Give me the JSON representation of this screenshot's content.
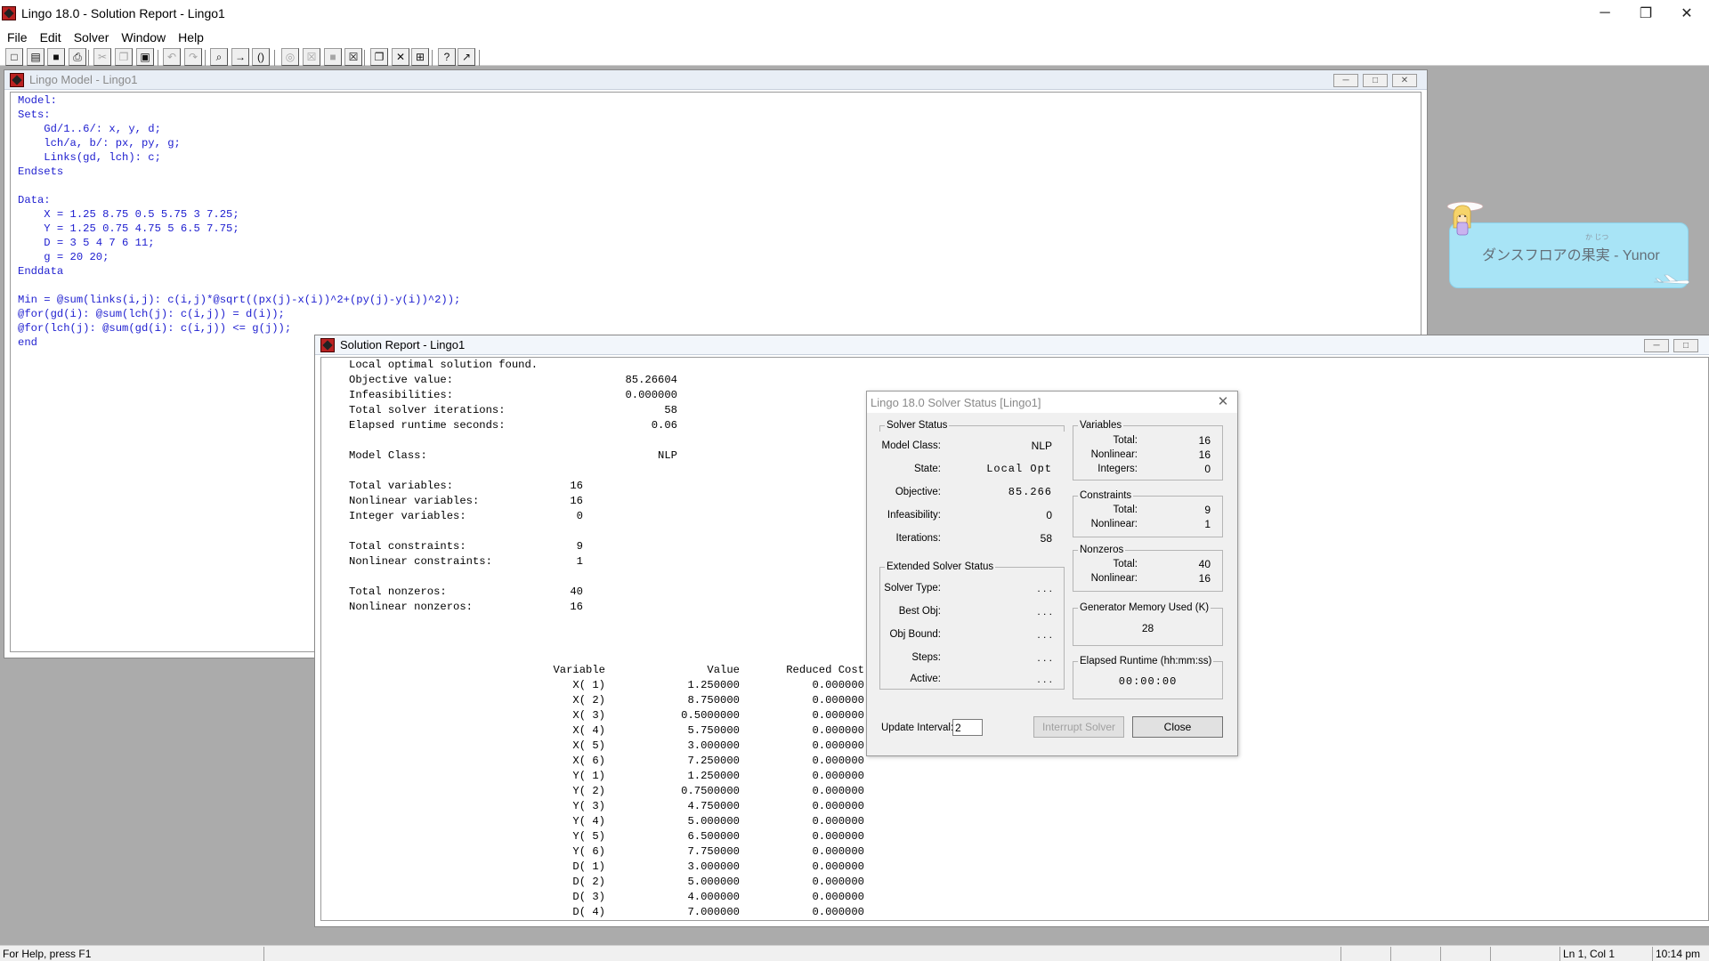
{
  "window": {
    "title": "Lingo 18.0 - Solution Report - Lingo1",
    "minimize": "─",
    "restore": "❐",
    "close": "✕"
  },
  "menu": [
    "File",
    "Edit",
    "Solver",
    "Window",
    "Help"
  ],
  "toolbar": {
    "buttons": [
      {
        "name": "new-icon",
        "glyph": "□"
      },
      {
        "name": "open-icon",
        "glyph": "▤"
      },
      {
        "name": "save-icon",
        "glyph": "■"
      },
      {
        "name": "print-icon",
        "glyph": "⎙"
      },
      {
        "name": "cut-icon",
        "glyph": "✂"
      },
      {
        "name": "copy-icon",
        "glyph": "❐"
      },
      {
        "name": "paste-icon",
        "glyph": "▣"
      },
      {
        "name": "undo-icon",
        "glyph": "↶"
      },
      {
        "name": "redo-icon",
        "glyph": "↷"
      },
      {
        "name": "find-icon",
        "glyph": "⌕"
      },
      {
        "name": "goto-line-icon",
        "glyph": "→"
      },
      {
        "name": "match-paren-icon",
        "glyph": "()"
      },
      {
        "name": "solve-icon",
        "glyph": "◎"
      },
      {
        "name": "interrupt-icon",
        "glyph": "☒"
      },
      {
        "name": "stop-icon",
        "glyph": "■"
      },
      {
        "name": "close-all-icon",
        "glyph": "☒"
      },
      {
        "name": "send-to-back-icon",
        "glyph": "❐"
      },
      {
        "name": "close-windows-icon",
        "glyph": "✕"
      },
      {
        "name": "tile-icon",
        "glyph": "⊞"
      },
      {
        "name": "help-icon",
        "glyph": "?"
      },
      {
        "name": "context-help-icon",
        "glyph": "↗"
      }
    ]
  },
  "model_window": {
    "title": "Lingo Model - Lingo1",
    "code": "Model:\nSets:\n    Gd/1..6/: x, y, d;\n    lch/a, b/: px, py, g;\n    Links(gd, lch): c;\nEndsets\n\nData:\n    X = 1.25 8.75 0.5 5.75 3 7.25;\n    Y = 1.25 0.75 4.75 5 6.5 7.75;\n    D = 3 5 4 7 6 11;\n    g = 20 20;\nEnddata\n\nMin = @sum(links(i,j): c(i,j)*@sqrt((px(j)-x(i))^2+(py(j)-y(i))^2));\n@for(gd(i): @sum(lch(j): c(i,j)) = d(i));\n@for(lch(j): @sum(gd(i): c(i,j)) <= g(j));\nend"
  },
  "report_window": {
    "title": "Solution Report - Lingo1",
    "header": "Local optimal solution found.",
    "summary": [
      {
        "label": "Objective value:",
        "value": "85.26604"
      },
      {
        "label": "Infeasibilities:",
        "value": "0.000000"
      },
      {
        "label": "Total solver iterations:",
        "value": "58"
      },
      {
        "label": "Elapsed runtime seconds:",
        "value": "0.06"
      }
    ],
    "model_class": {
      "label": "Model Class:",
      "value": "NLP"
    },
    "var_stats": [
      {
        "label": "Total variables:",
        "value": "16"
      },
      {
        "label": "Nonlinear variables:",
        "value": "16"
      },
      {
        "label": "Integer variables:",
        "value": "0"
      }
    ],
    "con_stats": [
      {
        "label": "Total constraints:",
        "value": "9"
      },
      {
        "label": "Nonlinear constraints:",
        "value": "1"
      }
    ],
    "nz_stats": [
      {
        "label": "Total nonzeros:",
        "value": "40"
      },
      {
        "label": "Nonlinear nonzeros:",
        "value": "16"
      }
    ],
    "table_headers": {
      "variable": "Variable",
      "value": "Value",
      "reduced_cost": "Reduced Cost"
    },
    "rows": [
      {
        "variable": "X( 1)",
        "value": "1.250000",
        "reduced_cost": "0.000000"
      },
      {
        "variable": "X( 2)",
        "value": "8.750000",
        "reduced_cost": "0.000000"
      },
      {
        "variable": "X( 3)",
        "value": "0.5000000",
        "reduced_cost": "0.000000"
      },
      {
        "variable": "X( 4)",
        "value": "5.750000",
        "reduced_cost": "0.000000"
      },
      {
        "variable": "X( 5)",
        "value": "3.000000",
        "reduced_cost": "0.000000"
      },
      {
        "variable": "X( 6)",
        "value": "7.250000",
        "reduced_cost": "0.000000"
      },
      {
        "variable": "Y( 1)",
        "value": "1.250000",
        "reduced_cost": "0.000000"
      },
      {
        "variable": "Y( 2)",
        "value": "0.7500000",
        "reduced_cost": "0.000000"
      },
      {
        "variable": "Y( 3)",
        "value": "4.750000",
        "reduced_cost": "0.000000"
      },
      {
        "variable": "Y( 4)",
        "value": "5.000000",
        "reduced_cost": "0.000000"
      },
      {
        "variable": "Y( 5)",
        "value": "6.500000",
        "reduced_cost": "0.000000"
      },
      {
        "variable": "Y( 6)",
        "value": "7.750000",
        "reduced_cost": "0.000000"
      },
      {
        "variable": "D( 1)",
        "value": "3.000000",
        "reduced_cost": "0.000000"
      },
      {
        "variable": "D( 2)",
        "value": "5.000000",
        "reduced_cost": "0.000000"
      },
      {
        "variable": "D( 3)",
        "value": "4.000000",
        "reduced_cost": "0.000000"
      },
      {
        "variable": "D( 4)",
        "value": "7.000000",
        "reduced_cost": "0.000000"
      }
    ]
  },
  "solver_status": {
    "title": "Lingo 18.0 Solver Status [Lingo1]",
    "solver_status": {
      "label": "Solver Status",
      "model_class_label": "Model Class:",
      "model_class": "NLP",
      "state_label": "State:",
      "state": "Local Opt",
      "objective_label": "Objective:",
      "objective": "85.266",
      "infeasibility_label": "Infeasibility:",
      "infeasibility": "0",
      "iterations_label": "Iterations:",
      "iterations": "58"
    },
    "extended": {
      "label": "Extended Solver Status",
      "solver_type_label": "Solver Type:",
      "solver_type": ". . .",
      "best_obj_label": "Best Obj:",
      "best_obj": ". . .",
      "obj_bound_label": "Obj Bound:",
      "obj_bound": ". . .",
      "steps_label": "Steps:",
      "steps": ". . .",
      "active_label": "Active:",
      "active": ". . ."
    },
    "variables": {
      "label": "Variables",
      "total_label": "Total:",
      "total": "16",
      "nonlinear_label": "Nonlinear:",
      "nonlinear": "16",
      "integers_label": "Integers:",
      "integers": "0"
    },
    "constraints": {
      "label": "Constraints",
      "total_label": "Total:",
      "total": "9",
      "nonlinear_label": "Nonlinear:",
      "nonlinear": "1"
    },
    "nonzeros": {
      "label": "Nonzeros",
      "total_label": "Total:",
      "total": "40",
      "nonlinear_label": "Nonlinear:",
      "nonlinear": "16"
    },
    "generator_memory": {
      "label": "Generator Memory Used (K)",
      "value": "28"
    },
    "elapsed_runtime": {
      "label": "Elapsed Runtime (hh:mm:ss)",
      "value": "00:00:00"
    },
    "update_interval_label": "Update Interval:",
    "update_interval": "2",
    "interrupt_label": "Interrupt Solver",
    "close_label": "Close"
  },
  "statusbar": {
    "help": "For Help, press F1",
    "position": "Ln 1, Col 1",
    "time": "10:14 pm"
  },
  "music_widget": {
    "song": "ダンスフロアの果実 - Yunor",
    "furigana": "か じつ"
  }
}
